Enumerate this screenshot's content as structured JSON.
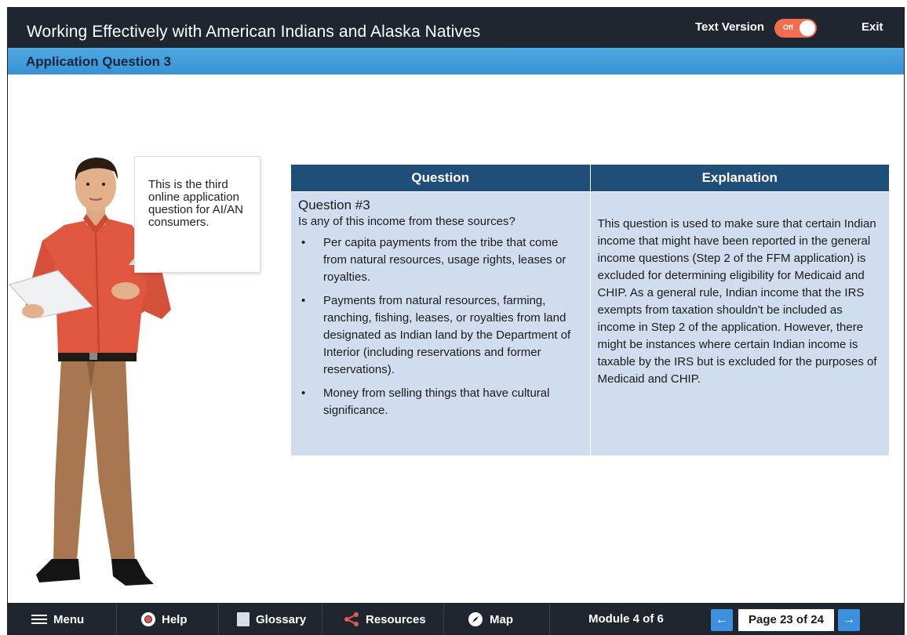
{
  "header": {
    "course_title": "Working Effectively with American Indians and Alaska Natives",
    "text_version_label": "Text Version",
    "toggle_state": "Off",
    "exit_label": "Exit"
  },
  "page": {
    "title": "Application Question 3"
  },
  "character": {
    "speech": "This is the third online application question for AI/AN consumers."
  },
  "table": {
    "headers": [
      "Question",
      "Explanation"
    ],
    "question": {
      "heading": "Question #3",
      "prompt": "Is any of this income from these sources?",
      "bullets": [
        "Per capita payments from the tribe that come from natural resources, usage rights, leases or royalties.",
        "Payments from natural resources, farming, ranching, fishing, leases, or royalties from land designated as Indian land by the Department of Interior (including reservations and former reservations).",
        "Money from selling things that have cultural significance."
      ]
    },
    "explanation": "This question is used to make sure that certain Indian income that might have been reported in the general income questions (Step 2 of the FFM application) is excluded for determining eligibility for Medicaid and CHIP. As a general rule, Indian income that the IRS exempts from taxation shouldn't be included as income in Step 2 of the application. However, there might be instances where certain Indian income is taxable by the IRS but is excluded for the purposes of Medicaid and CHIP."
  },
  "footer": {
    "menu_label": "Menu",
    "help_label": "Help",
    "glossary_label": "Glossary",
    "resources_label": "Resources",
    "map_label": "Map",
    "module_label": "Module 4 of 6",
    "page_label": "Page 23 of 24",
    "prev_arrow": "←",
    "next_arrow": "→"
  },
  "colors": {
    "header_bg": "#1f2630",
    "title_bar": "#4fa9e3",
    "table_header": "#1f4e79",
    "table_cell": "#d0ddef",
    "toggle": "#f26d4f",
    "nav_button": "#3d8fe0"
  },
  "icons": [
    "menu-icon",
    "help-icon",
    "glossary-icon",
    "resources-icon",
    "map-icon",
    "prev-arrow-icon",
    "next-arrow-icon"
  ]
}
